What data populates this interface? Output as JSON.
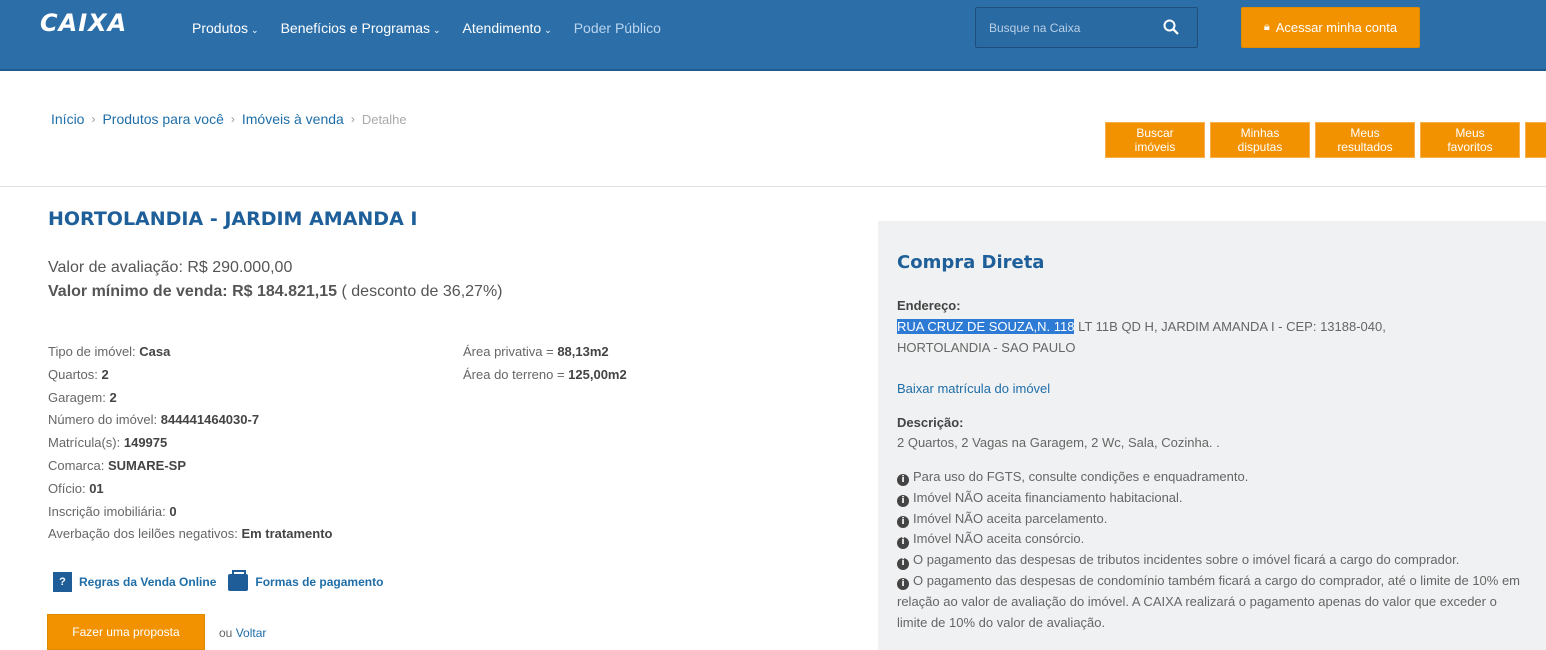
{
  "header": {
    "logo": "CAIXA",
    "nav": [
      {
        "label": "Produtos",
        "dropdown": true
      },
      {
        "label": "Benefícios e Programas",
        "dropdown": true
      },
      {
        "label": "Atendimento",
        "dropdown": true
      },
      {
        "label": "Poder Público",
        "dropdown": false
      }
    ],
    "search_placeholder": "Busque na Caixa",
    "login_label": "Acessar minha conta",
    "brand_color": "#2c6ea8",
    "accent_color": "#f39200"
  },
  "breadcrumb": [
    "Início",
    "Produtos para você",
    "Imóveis à venda"
  ],
  "breadcrumb_current": "Detalhe",
  "actions": [
    {
      "line1": "Buscar",
      "line2": "imóveis"
    },
    {
      "line1": "Minhas",
      "line2": "disputas"
    },
    {
      "line1": "Meus",
      "line2": "resultados"
    },
    {
      "line1": "Meus",
      "line2": "favoritos"
    }
  ],
  "property": {
    "title": "HORTOLANDIA - JARDIM AMANDA I",
    "valuation_label": "Valor de avaliação:",
    "valuation_value": "R$ 290.000,00",
    "min_label": "Valor mínimo de venda:",
    "min_value": "R$ 184.821,15",
    "discount": "( desconto de 36,27%)",
    "details": [
      {
        "label": "Tipo de imóvel:",
        "value": "Casa"
      },
      {
        "label": "Quartos:",
        "value": "2"
      },
      {
        "label": "Garagem:",
        "value": "2"
      },
      {
        "label": "Número do imóvel:",
        "value": "844441464030-7"
      },
      {
        "label": "Matrícula(s):",
        "value": "149975"
      },
      {
        "label": "Comarca:",
        "value": "SUMARE-SP"
      },
      {
        "label": "Ofício:",
        "value": "01"
      },
      {
        "label": "Inscrição imobiliária:",
        "value": "0"
      },
      {
        "label": "Averbação dos leilões negativos:",
        "value": "Em tratamento"
      }
    ],
    "areas": [
      {
        "label": "Área privativa =",
        "value": "88,13m2"
      },
      {
        "label": "Área do terreno =",
        "value": "125,00m2"
      }
    ],
    "rules_link": "Regras da Venda Online",
    "payment_link": "Formas de pagamento",
    "propose_button": "Fazer uma proposta",
    "back_prefix": "ou",
    "back_link": "Voltar"
  },
  "panel": {
    "title": "Compra Direta",
    "address_label": "Endereço:",
    "address_highlight": "RUA CRUZ DE SOUZA,N. 118",
    "address_rest": " LT 11B QD H, JARDIM AMANDA I - CEP: 13188-040,",
    "address_line2": "HORTOLANDIA - SAO PAULO",
    "download_link": "Baixar matrícula do imóvel",
    "description_label": "Descrição:",
    "description": "2 Quartos, 2 Vagas na Garagem, 2 Wc, Sala, Cozinha. .",
    "notes": [
      "Para uso do FGTS, consulte condições e enquadramento.",
      "Imóvel NÃO aceita financiamento habitacional.",
      "Imóvel NÃO aceita parcelamento.",
      "Imóvel NÃO aceita consórcio.",
      "O pagamento das despesas de tributos incidentes sobre o imóvel ficará a cargo do comprador.",
      "O pagamento das despesas de condomínio também ficará a cargo do comprador, até o limite de 10% em relação ao valor de avaliação do imóvel. A CAIXA realizará o pagamento apenas do valor que exceder o limite de 10% do valor de avaliação."
    ]
  }
}
